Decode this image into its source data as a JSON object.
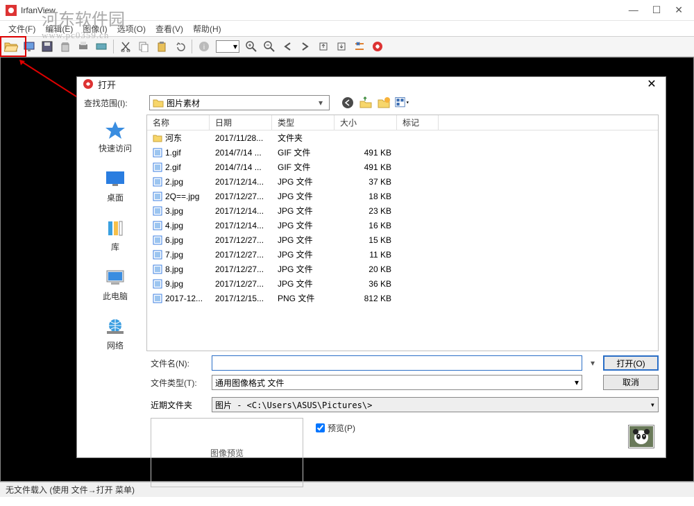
{
  "titlebar": {
    "title": "IrfanView"
  },
  "menubar": {
    "file": "文件(F)",
    "edit": "编辑(E)",
    "image": "图像(I)",
    "options": "选项(O)",
    "view": "查看(V)",
    "help": "帮助(H)"
  },
  "statusbar": {
    "text": "无文件载入 (使用 文件→打开 菜单)"
  },
  "watermark": {
    "name": "河东软件园",
    "url": "www.pc0359.cn"
  },
  "dialog": {
    "title": "打开",
    "lookin_label": "查找范围(I):",
    "lookin_value": "图片素材",
    "columns": {
      "name": "名称",
      "date": "日期",
      "type": "类型",
      "size": "大小",
      "tag": "标记"
    },
    "rows": [
      {
        "name": "河东",
        "date": "2017/11/28...",
        "type": "文件夹",
        "size": "",
        "is_folder": true
      },
      {
        "name": "1.gif",
        "date": "2014/7/14 ...",
        "type": "GIF 文件",
        "size": "491 KB"
      },
      {
        "name": "2.gif",
        "date": "2014/7/14 ...",
        "type": "GIF 文件",
        "size": "491 KB"
      },
      {
        "name": "2.jpg",
        "date": "2017/12/14...",
        "type": "JPG 文件",
        "size": "37 KB"
      },
      {
        "name": "2Q==.jpg",
        "date": "2017/12/27...",
        "type": "JPG 文件",
        "size": "18 KB"
      },
      {
        "name": "3.jpg",
        "date": "2017/12/14...",
        "type": "JPG 文件",
        "size": "23 KB"
      },
      {
        "name": "4.jpg",
        "date": "2017/12/14...",
        "type": "JPG 文件",
        "size": "16 KB"
      },
      {
        "name": "6.jpg",
        "date": "2017/12/27...",
        "type": "JPG 文件",
        "size": "15 KB"
      },
      {
        "name": "7.jpg",
        "date": "2017/12/27...",
        "type": "JPG 文件",
        "size": "11 KB"
      },
      {
        "name": "8.jpg",
        "date": "2017/12/27...",
        "type": "JPG 文件",
        "size": "20 KB"
      },
      {
        "name": "9.jpg",
        "date": "2017/12/27...",
        "type": "JPG 文件",
        "size": "36 KB"
      },
      {
        "name": "2017-12...",
        "date": "2017/12/15...",
        "type": "PNG 文件",
        "size": "812 KB"
      }
    ],
    "sidebar": [
      {
        "label": "快速访问",
        "icon": "star"
      },
      {
        "label": "桌面",
        "icon": "desktop"
      },
      {
        "label": "库",
        "icon": "library"
      },
      {
        "label": "此电脑",
        "icon": "pc"
      },
      {
        "label": "网络",
        "icon": "network"
      }
    ],
    "filename_label": "文件名(N):",
    "filename_value": "",
    "filetype_label": "文件类型(T):",
    "filetype_value": "通用图像格式 文件",
    "open_btn": "打开(O)",
    "cancel_btn": "取消",
    "recent_label": "近期文件夹",
    "recent_value": "图片  -  <C:\\Users\\ASUS\\Pictures\\>",
    "preview_label": "图像预览",
    "preview_chk": "预览(P)"
  }
}
